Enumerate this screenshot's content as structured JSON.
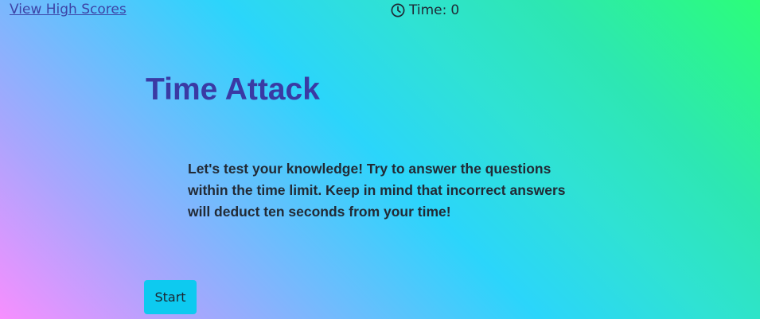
{
  "header": {
    "high_scores_link": "View High Scores",
    "clock_icon": "clock-icon",
    "timer_label": "Time:",
    "timer_value": "0"
  },
  "main": {
    "title": "Time Attack",
    "intro_text": "Let's test your knowledge! Try to answer the questions within the time limit. Keep in mind that incorrect answers will deduct ten seconds from your time!",
    "start_label": "Start"
  },
  "colors": {
    "title": "#3a3aa4",
    "link": "#3d44a6",
    "start_button": "#0dcaf0",
    "gradient_start": "#f78ffe",
    "gradient_mid": "#2bd5fb",
    "gradient_end": "#2cfe79"
  }
}
